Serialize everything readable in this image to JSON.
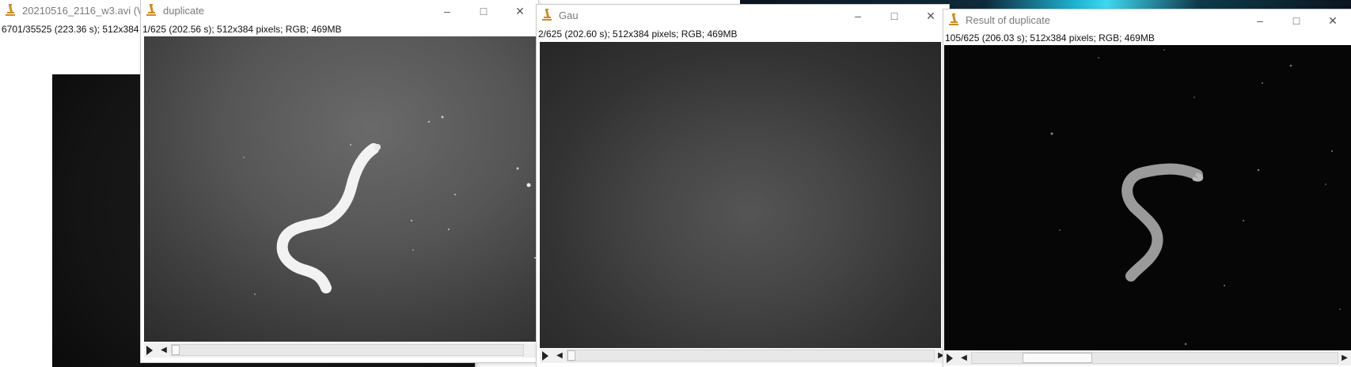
{
  "windows": {
    "avi": {
      "title": "20210516_2116_w3.avi (V)",
      "info": "6701/35525 (223.36 s); 512x384"
    },
    "duplicate": {
      "title": "duplicate",
      "info": "1/625 (202.56 s); 512x384 pixels; RGB; 469MB",
      "slider_position": 0.0
    },
    "gau": {
      "title": "Gau",
      "info": "2/625 (202.60 s); 512x384 pixels; RGB; 469MB",
      "slider_position": 0.0
    },
    "result": {
      "title": "Result of duplicate",
      "info": "105/625 (206.03 s); 512x384 pixels; RGB; 469MB",
      "slider_position": 0.17
    }
  },
  "icons": {
    "app": "imagej-microscope-icon",
    "minimize": "minimize-icon",
    "maximize": "maximize-icon",
    "close": "close-icon",
    "play": "play-icon",
    "scroll_left": "arrow-left-icon",
    "scroll_right": "arrow-right-icon"
  },
  "colors": {
    "app_icon": "#d08a1e",
    "title_text": "#7a7a7a",
    "scrollbar_bg": "#f0f0f0"
  }
}
